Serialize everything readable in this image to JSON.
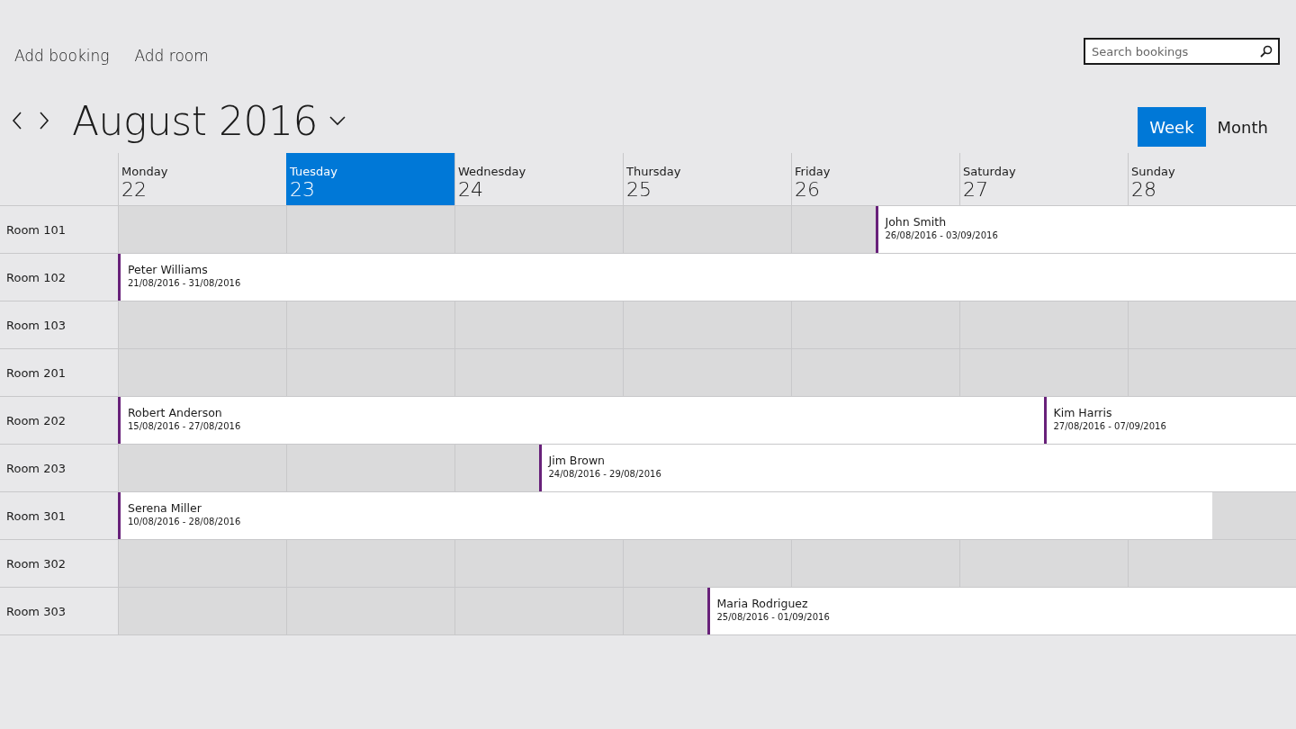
{
  "toolbar": {
    "actions": [
      "Add booking",
      "Add room"
    ],
    "search": {
      "placeholder": "Search bookings"
    }
  },
  "period": {
    "title": "August 2016"
  },
  "views": [
    {
      "label": "Week",
      "selected": true
    },
    {
      "label": "Month",
      "selected": false
    }
  ],
  "days": [
    {
      "name": "Monday",
      "date": "22",
      "selected": false
    },
    {
      "name": "Tuesday",
      "date": "23",
      "selected": true
    },
    {
      "name": "Wednesday",
      "date": "24",
      "selected": false
    },
    {
      "name": "Thursday",
      "date": "25",
      "selected": false
    },
    {
      "name": "Friday",
      "date": "26",
      "selected": false
    },
    {
      "name": "Saturday",
      "date": "27",
      "selected": false
    },
    {
      "name": "Sunday",
      "date": "28",
      "selected": false
    }
  ],
  "rooms": [
    {
      "name": "Room 101",
      "bookings": [
        {
          "guest": "John Smith",
          "dates": "26/08/2016 - 03/09/2016"
        }
      ]
    },
    {
      "name": "Room 102",
      "bookings": [
        {
          "guest": "Peter Williams",
          "dates": "21/08/2016 - 31/08/2016"
        }
      ]
    },
    {
      "name": "Room 103"
    },
    {
      "name": "Room 201"
    },
    {
      "name": "Room 202",
      "bookings": [
        {
          "guest": "Robert Anderson",
          "dates": "15/08/2016 - 27/08/2016"
        },
        {
          "guest": "Kim Harris",
          "dates": "27/08/2016 - 07/09/2016"
        }
      ]
    },
    {
      "name": "Room 203",
      "bookings": [
        {
          "guest": "Jim Brown",
          "dates": "24/08/2016 - 29/08/2016"
        }
      ]
    },
    {
      "name": "Room 301",
      "bookings": [
        {
          "guest": "Serena Miller",
          "dates": "10/08/2016 - 28/08/2016"
        }
      ]
    },
    {
      "name": "Room 302"
    },
    {
      "name": "Room 303",
      "bookings": [
        {
          "guest": "Maria Rodriguez",
          "dates": "25/08/2016 - 01/09/2016"
        }
      ]
    }
  ]
}
